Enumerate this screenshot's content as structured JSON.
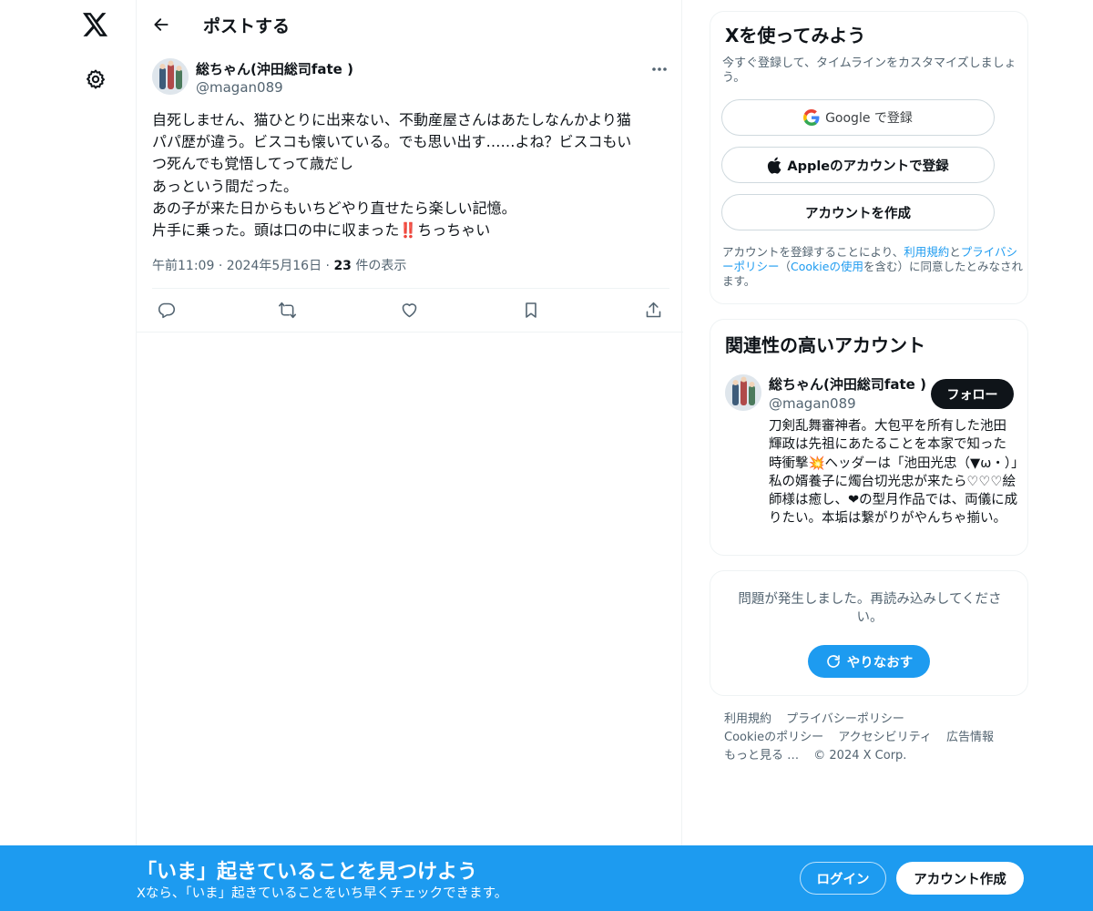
{
  "nav": {
    "logo_icon": "x-logo-icon",
    "settings_icon": "gear-icon"
  },
  "header": {
    "title": "ポストする"
  },
  "post": {
    "author_name": "総ちゃん(沖田総司fate )",
    "author_handle": "@magan089",
    "text": "自死しません、猫ひとりに出来ない、不動産屋さんはあたしなんかより猫\nパパ歴が違う。ビスコも懐いている。でも思い出す……よね？ビスコもい\nつ死んでも覚悟してって歳だし\nあっという間だった。\nあの子が来た日からもいちどやり直せたら楽しい記憶。\n片手に乗った。頭は口の中に収まった‼️ちっちゃい",
    "time": "午前11:09",
    "date": "2024年5月16日",
    "views_count": "23",
    "views_label": "件の表示"
  },
  "signup_card": {
    "title": "Xを使ってみよう",
    "subtitle": "今すぐ登録して、タイムラインをカスタマイズしましょう。",
    "google_label": "Google で登録",
    "apple_label": "Appleのアカウントで登録",
    "create_label": "アカウントを作成",
    "terms_pre": "アカウントを登録することにより、",
    "terms_link1": "利用規約",
    "terms_mid": "と",
    "terms_link2": "プライバシーポリシー",
    "terms_mid2": "（",
    "terms_link3": "Cookieの使用",
    "terms_post": "を含む）に同意したとみなされます。"
  },
  "relevant_card": {
    "title": "関連性の高いアカウント",
    "name": "総ちゃん(沖田総司fate )",
    "handle": "@magan089",
    "follow_label": "フォロー",
    "bio": "刀剣乱舞審神者。大包平を所有した池田輝政は先祖にあたることを本家で知った時衝撃💥ヘッダーは「池田光忠（▼ω・）」私の婿養子に燭台切光忠が来たら♡♡♡絵師様は癒し、❤︎の型月作品では、両儀に成りたい。本垢は繋がりがやんちゃ揃い。"
  },
  "error_card": {
    "message": "問題が発生しました。再読み込みしてください。",
    "retry_label": "やりなおす"
  },
  "footer": {
    "links": [
      "利用規約",
      "プライバシーポリシー",
      "Cookieのポリシー",
      "アクセシビリティ",
      "広告情報",
      "もっと見る …"
    ],
    "copyright": "© 2024 X Corp."
  },
  "banner": {
    "title": "「いま」起きていることを見つけよう",
    "subtitle": "Xなら、「いま」起きていることをいち早くチェックできます。",
    "login_label": "ログイン",
    "signup_label": "アカウント作成"
  },
  "colors": {
    "accent": "#1d9bf0",
    "text": "#0f1419",
    "secondary": "#536471",
    "border": "#eff3f4"
  }
}
